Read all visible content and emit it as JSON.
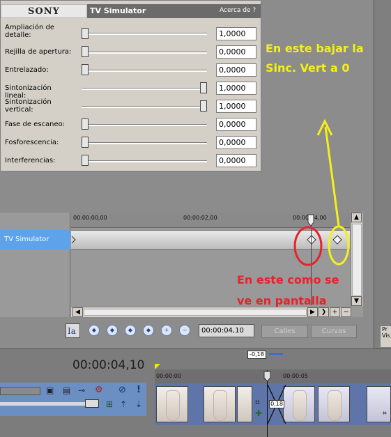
{
  "plugin": {
    "brand": "SONY",
    "name": "TV Simulator",
    "about": "Acerca de  ?",
    "params": [
      {
        "label": "Ampliación de detalle:",
        "value": "1,0000",
        "level": 0.0
      },
      {
        "label": "Rejilla de apertura:",
        "value": "0,0000",
        "level": 0.0
      },
      {
        "label": "Entrelazado:",
        "value": "0,0000",
        "level": 0.0
      },
      {
        "label": "Sintonización lineal:",
        "value": "1,0000",
        "level": 1.0
      },
      {
        "label": "Sintonización vertical:",
        "value": "1,0000",
        "level": 1.0
      },
      {
        "label": "Fase de escaneo:",
        "value": "0,0000",
        "level": 0.0
      },
      {
        "label": "Fosforescencia:",
        "value": "0,0000",
        "level": 0.0
      },
      {
        "label": "Interferencias:",
        "value": "0,0000",
        "level": 0.0
      }
    ]
  },
  "keyframes": {
    "track_label": "TV Simulator",
    "ruler": [
      "00:00:00,00",
      "00:00:02,00",
      "00:00:04,00"
    ],
    "time": "00:00:04,10",
    "tab_lanes": "Calles",
    "tab_curves": "Curvas"
  },
  "timeline": {
    "time": "00:00:04,10",
    "ruler": [
      "00:00:00",
      "00:00:05"
    ],
    "offset": "-0,18",
    "transition": "0,18"
  },
  "right_col": {
    "line1": "Pr",
    "line2": "Vis"
  },
  "annotations": {
    "yellow_line1": "En este bajar la",
    "yellow_line2": "Sinc. Vert a 0",
    "red_line1": "En este como se",
    "red_line2": "ve en pantalla"
  },
  "colors": {
    "yellow": "#f5f01a",
    "red": "#e8222a",
    "track_blue": "#5ea3ea"
  }
}
